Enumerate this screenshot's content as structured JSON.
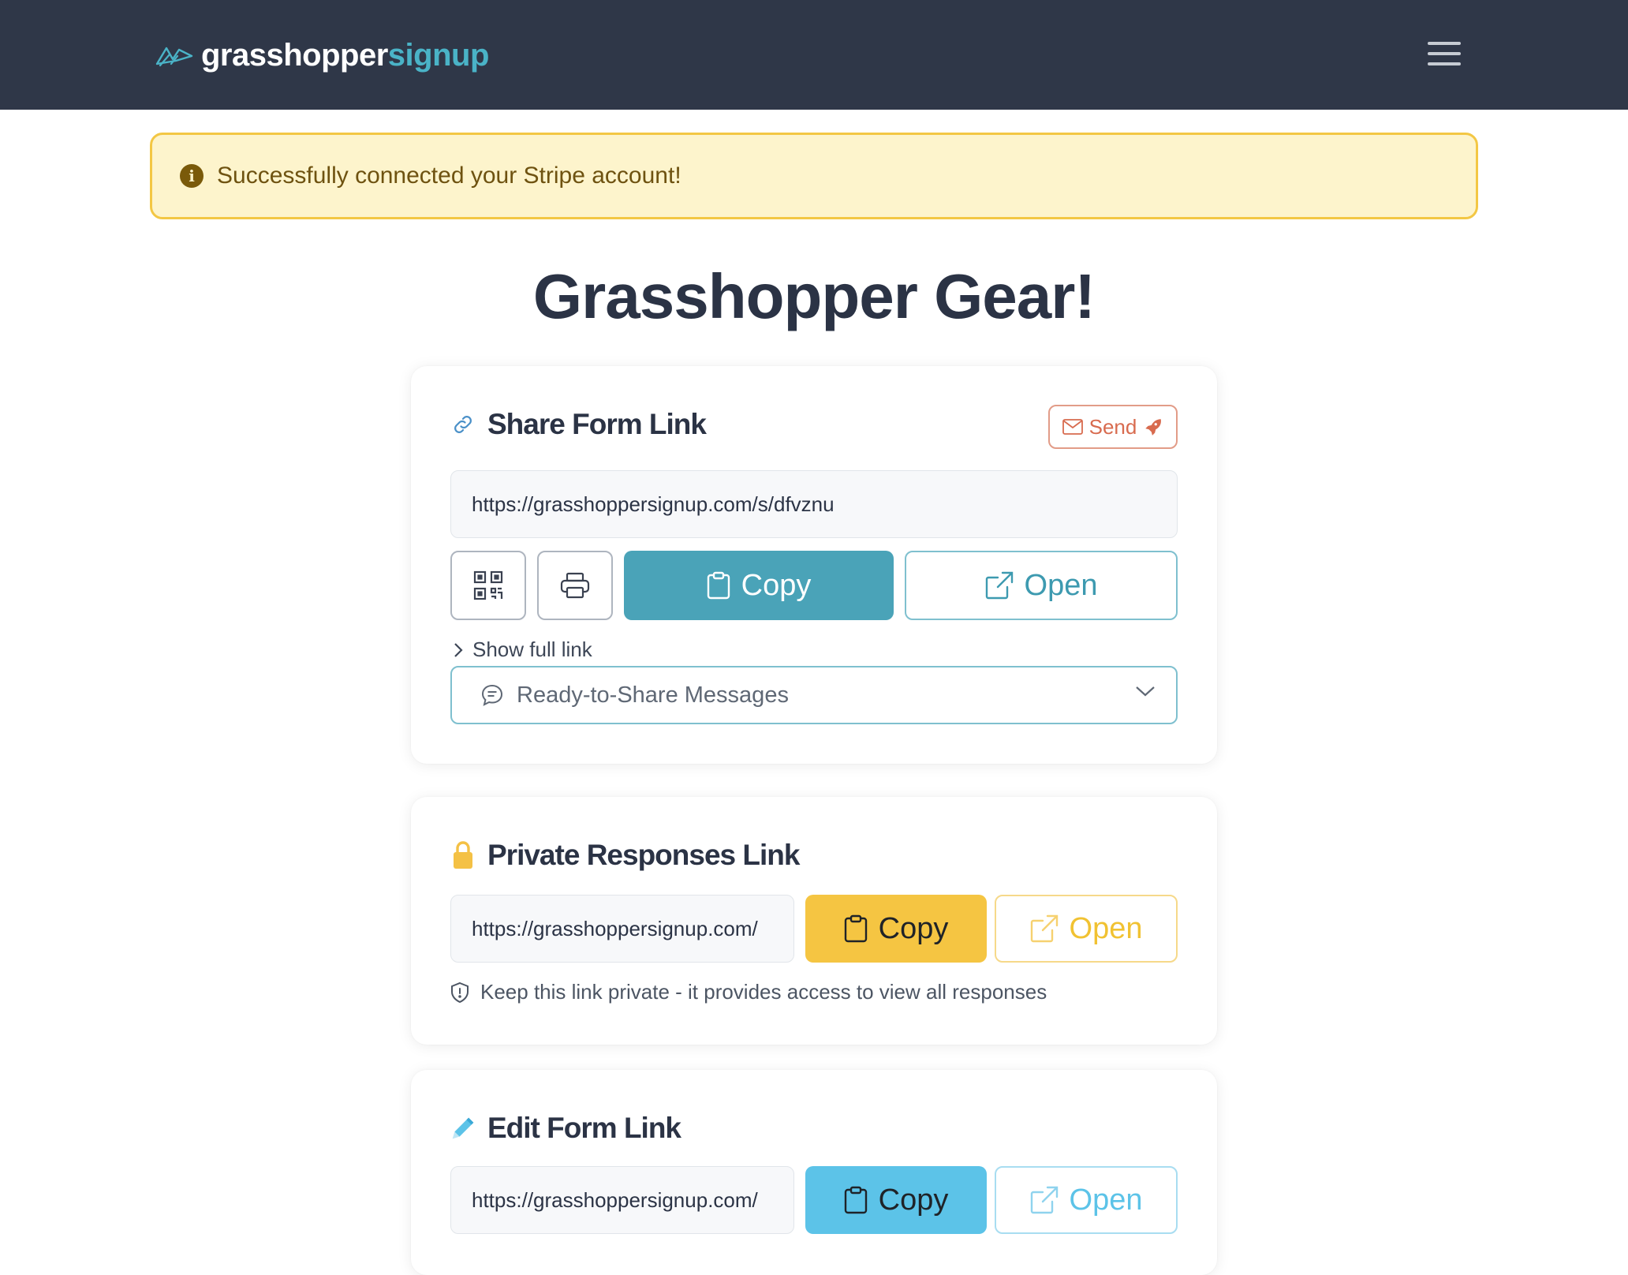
{
  "navbar": {
    "brand_part1": "grasshopper",
    "brand_part2": "signup",
    "menu_icon": "hamburger-menu-icon"
  },
  "alert": {
    "icon": "info-circle-icon",
    "message": "Successfully connected your Stripe account!"
  },
  "page": {
    "title": "Grasshopper Gear!"
  },
  "share_card": {
    "title": "Share Form Link",
    "icon": "link-icon",
    "send_label": "Send",
    "url": "https://grasshoppersignup.com/s/dfvznu",
    "copy_label": "Copy",
    "open_label": "Open",
    "show_full_link": "Show full link",
    "messages_label": "Ready-to-Share Messages"
  },
  "private_card": {
    "title": "Private Responses Link",
    "icon": "lock-icon",
    "url": "https://grasshoppersignup.com/",
    "copy_label": "Copy",
    "open_label": "Open",
    "note": "Keep this link private - it provides access to view all responses"
  },
  "edit_card": {
    "title": "Edit Form Link",
    "icon": "pencil-icon",
    "url": "https://grasshoppersignup.com/",
    "copy_label": "Copy",
    "open_label": "Open"
  },
  "colors": {
    "navbar_bg": "#2f3748",
    "brand_accent": "#4ab3c7",
    "alert_bg": "#fdf4cc",
    "alert_border": "#f3c744",
    "share_accent": "#4aa3b8",
    "private_accent": "#f5c542",
    "edit_accent": "#5cc3e8",
    "send_accent": "#d86b4f"
  }
}
